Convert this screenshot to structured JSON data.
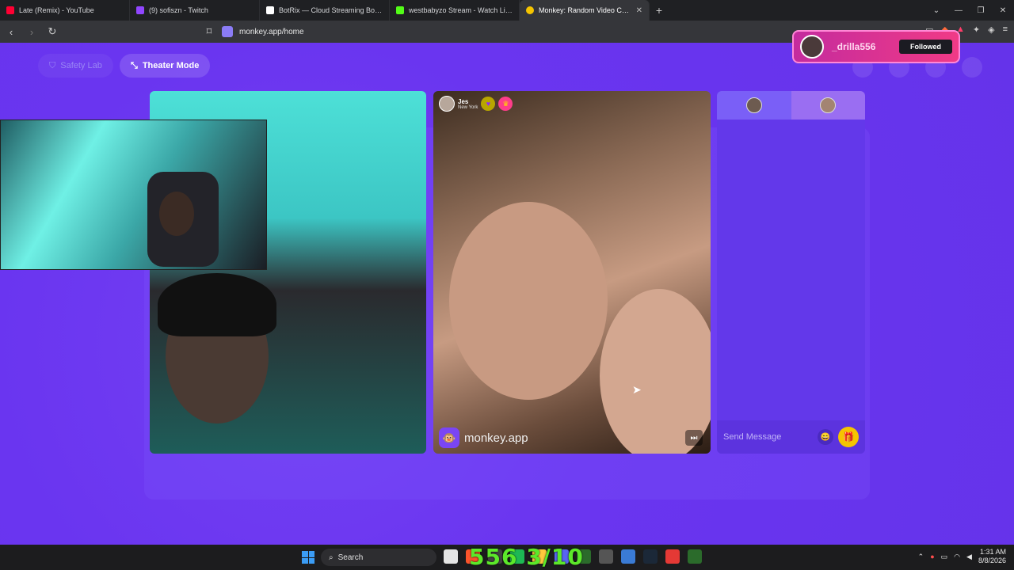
{
  "browser": {
    "tabs": [
      {
        "title": "Late (Remix) - YouTube",
        "color": "#ff0033",
        "active": false
      },
      {
        "title": "(9) sofiszn - Twitch",
        "color": "#9146ff",
        "active": false
      },
      {
        "title": "BotRix — Cloud Streaming Bot for Tw",
        "color": "#ffffff",
        "active": false
      },
      {
        "title": "westbabyzo Stream - Watch Live on K",
        "color": "#53fc18",
        "active": false
      },
      {
        "title": "Monkey: Random Video Chat",
        "color": "#f5c400",
        "active": true
      }
    ],
    "new_tab": "+",
    "address": "monkey.app/home"
  },
  "header": {
    "safety_lab": "Safety Lab",
    "theater_mode": "Theater Mode"
  },
  "partner": {
    "name": "Jes",
    "location": "New York"
  },
  "brand": {
    "name": "monkey.app",
    "icon": "🐵"
  },
  "chat": {
    "placeholder": "Send Message"
  },
  "alert": {
    "username": "_drilla556",
    "button": "Followed"
  },
  "overlay": {
    "counter": "556 3/10"
  },
  "taskbar": {
    "search": "Search",
    "time": "1:31 AM",
    "date": "8/8/2026"
  },
  "colors": {
    "page_bg": "#6a35f0",
    "gift": "#f5c400",
    "alert": "#f03a86",
    "counter": "#5ce82a"
  }
}
